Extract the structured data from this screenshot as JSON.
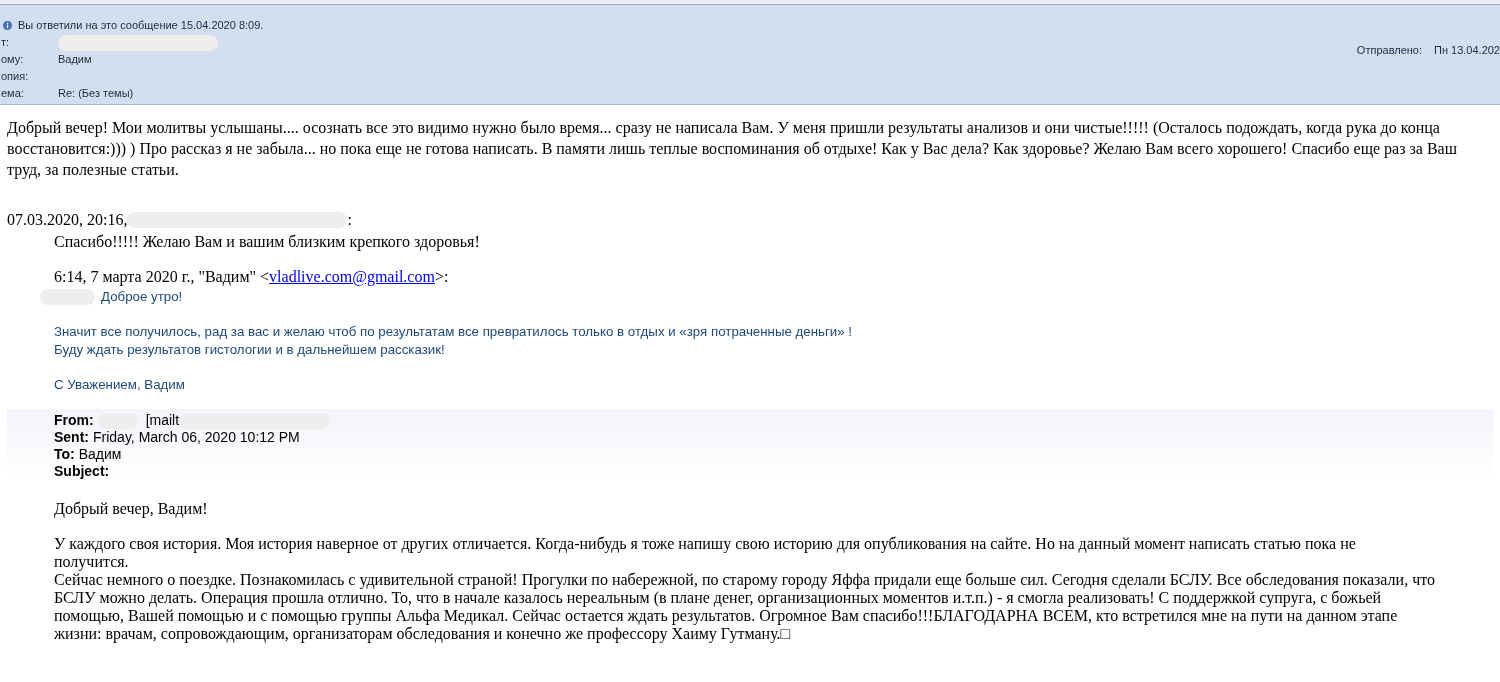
{
  "notice": {
    "text": "Вы ответили на это сообщение 15.04.2020 8:09."
  },
  "header_fields": [
    {
      "label": "т:",
      "redacted": true
    },
    {
      "label": "ому:",
      "value": "Вадим",
      "redacted": false
    },
    {
      "label": "опия:",
      "redacted": false
    },
    {
      "label": "ема:",
      "value": "Re: (Без темы)",
      "redacted": false
    }
  ],
  "sent": {
    "label": "Отправлено:",
    "value": "Пн 13.04.202"
  },
  "reply_text": "Добрый вечер! Мои молитвы услышаны....  осознать все это видимо нужно было время... сразу не написала Вам. У меня пришли результаты анализов и они чистые!!!!!  (Осталось подождать, когда рука до конца восстановится:)))  ) Про рассказ я не забыла... но пока еще не готова написать. В памяти лишь теплые воспоминания об отдыхе!  Как у Вас дела? Как здоровье? Желаю Вам всего хорошего! Спасибо еще раз за Ваш труд, за полезные статьи.",
  "quote": {
    "attribution": "07.03.2020, 20:16,",
    "attribution_suffix": ":",
    "redacted": true,
    "text": "Спасибо!!!!! Желаю Вам и вашим близким  крепкого здоровья!"
  },
  "nested_attribution": {
    "text": "6:14, 7 марта 2020 г., \"Вадим\" <",
    "link": "vladlive.com@gmail.com",
    "suffix": ">:"
  },
  "vadim_message": {
    "greeting": "Доброе утро!",
    "redacted": true,
    "lines": [
      "Значит все получилось, рад за вас и желаю чтоб по результатам все превратилось только в отдых и «зря потраченные деньги» !",
      "Буду ждать результатов гистологии и в дальнейшем рассказик!"
    ],
    "signature": "С Уважением, Вадим"
  },
  "original_header": [
    {
      "label": "From:",
      "value": "[mailt",
      "redacted": true
    },
    {
      "label": "Sent:",
      "value": "Friday, March 06, 2020 10:12 PM",
      "redacted": false
    },
    {
      "label": "To:",
      "value": "Вадим",
      "redacted": false
    },
    {
      "label": "Subject:",
      "redacted": false
    }
  ],
  "original_body": {
    "greeting": "Добрый вечер, Вадим!",
    "paragraphs": [
      "У каждого своя история. Моя история наверное от других отличается. Когда-нибудь я тоже напишу свою историю  для опубликования на сайте. Но на данный момент написать статью пока не",
      "получится.",
      "Сейчас немного о поездке. Познакомилась с удивительной страной! Прогулки по набережной, по старому городу Яффа придали еще больше сил. Сегодня сделали БСЛУ. Все обследования показали, что БСЛУ можно делать. Операция прошла отлично. То, что в начале казалось нереальным (в плане денег, организационных моментов и.т.п.)  - я смогла реализовать! С поддержкой супруга, с божьей помощью, Вашей помощью и с помощью группы Альфа Медикал. Сейчас остается ждать результатов. Огромное Вам спасибо!!!БЛАГОДАРНА ВСЕМ, кто встретился мне на пути на данном этапе жизни: врачам, сопровождающим, организаторам обследования и конечно же профессору Хаиму Гутману.□"
    ]
  }
}
